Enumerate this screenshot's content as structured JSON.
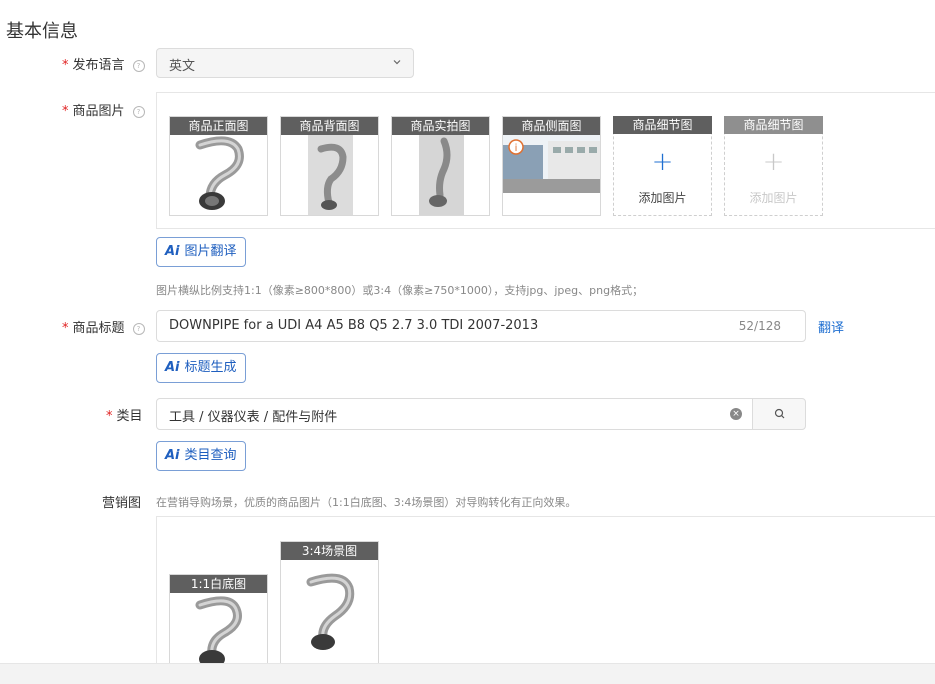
{
  "section": {
    "title": "基本信息"
  },
  "language": {
    "label": "发布语言",
    "value": "英文"
  },
  "images": {
    "label": "商品图片",
    "tiles": [
      {
        "caption": "商品正面图"
      },
      {
        "caption": "商品背面图"
      },
      {
        "caption": "商品实拍图"
      },
      {
        "caption": "商品侧面图"
      }
    ],
    "add_tiles": [
      {
        "caption": "商品细节图",
        "text": "添加图片"
      },
      {
        "caption": "商品细节图",
        "text": "添加图片"
      }
    ],
    "ai_button": "图片翻译",
    "hint": "图片横纵比例支持1:1（像素≥800*800）或3:4（像素≥750*1000），支持jpg、jpeg、png格式；"
  },
  "title_field": {
    "label": "商品标题",
    "value": "DOWNPIPE for a UDI A4 A5 B8 Q5 2.7 3.0 TDI 2007-2013",
    "counter": "52/128",
    "translate_link": "翻译",
    "ai_button": "标题生成"
  },
  "category": {
    "label": "类目",
    "value": "工具 / 仪器仪表 / 配件与附件",
    "ai_button": "类目查询"
  },
  "marketing": {
    "label": "营销图",
    "hint": "在营销导购场景，优质的商品图片（1:1白底图、3:4场景图）对导购转化有正向效果。",
    "tiles": [
      {
        "caption": "1:1白底图"
      },
      {
        "caption": "3:4场景图"
      }
    ]
  },
  "ai_icon_text": "Ai",
  "colors": {
    "accent": "#1f6fd1",
    "required": "#e02020",
    "caption_bg": "#5f5f5f"
  }
}
